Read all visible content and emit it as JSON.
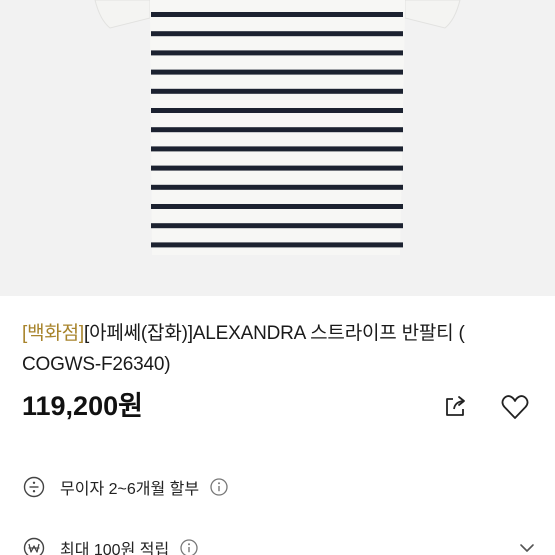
{
  "product": {
    "store_tag": "[백화점]",
    "title_rest": "[아페쎄(잡화)]ALEXANDRA 스트라이프 반팔티 ( COGWS-F26340)",
    "price": "119,200원",
    "image_icon": "striped-shirt-photo"
  },
  "benefits": [
    {
      "icon": "divide-icon",
      "text": "무이자 2~6개월 할부"
    },
    {
      "icon": "won-coin-icon",
      "text": "최대 100원 적립"
    }
  ],
  "colors": {
    "store_tag": "#a8842c",
    "stripe": "#1c2230",
    "shirt": "#f7f7f5",
    "background": "#f2f2f2"
  }
}
